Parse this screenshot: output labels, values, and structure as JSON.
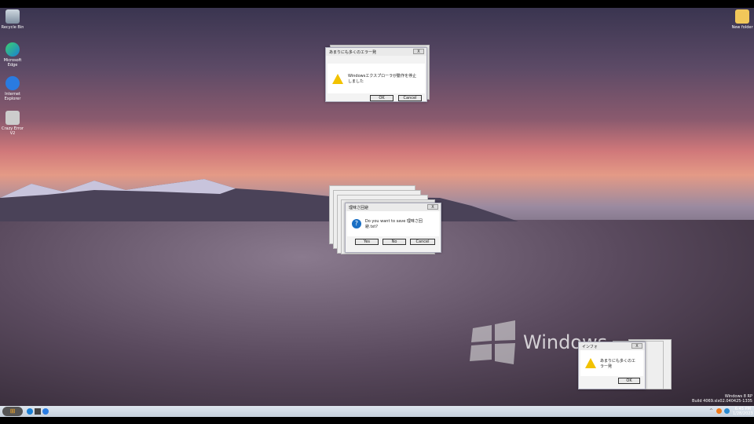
{
  "desktop": {
    "icons": [
      {
        "label": "Recycle Bin",
        "icon": "recycle-bin-icon"
      },
      {
        "label": "Microsoft Edge",
        "icon": "edge-icon"
      },
      {
        "label": "Internet Explorer",
        "icon": "ie-icon"
      },
      {
        "label": "Crazy Error V2",
        "icon": "crazy-error-icon"
      },
      {
        "label": "New folder",
        "icon": "folder-icon"
      }
    ],
    "watermark_logo": "Windows",
    "version_line1": "Windows 8 RP",
    "version_line2": "Build 4069.slx02.040425-1335"
  },
  "dialogs": [
    {
      "title": "あまりにも多くのエラー発",
      "message": "Windowsエクスプローラが動作を停止しました",
      "icon": "warning-icon",
      "buttons": [
        "OK",
        "Cancel"
      ],
      "close": "X"
    },
    {
      "title": "理味さ回避",
      "message": "Do you want to save 理味さ回避.txt?",
      "icon": "question-icon",
      "buttons": [
        "Yes",
        "No",
        "Cancel"
      ],
      "close": "X"
    },
    {
      "title": "インフォ",
      "message": "あまりにも多くのエラー発",
      "icon": "warning-icon",
      "buttons": [
        "OK"
      ],
      "close": "X"
    }
  ],
  "taskbar": {
    "clock_time": "6:45 PM",
    "clock_date": "1/28/2023"
  },
  "colors": {
    "accent": "#1a6fc4",
    "warning": "#f2c200"
  }
}
